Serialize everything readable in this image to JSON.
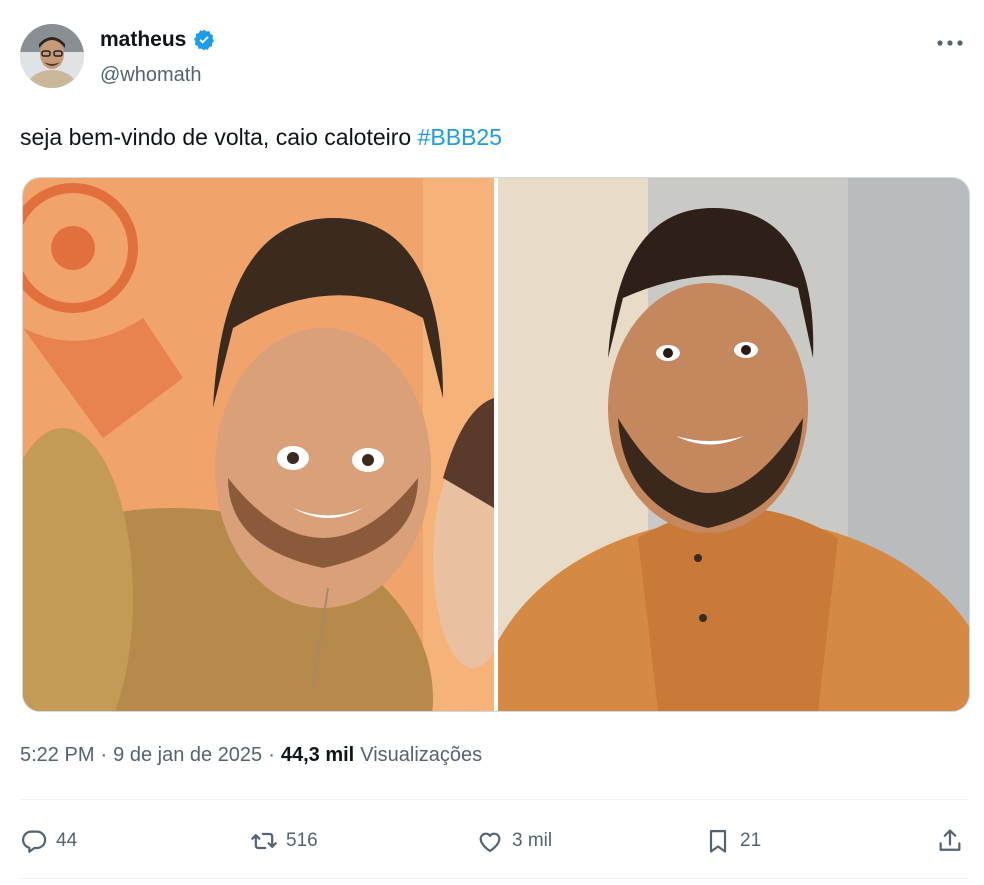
{
  "tweet": {
    "author": {
      "name": "matheus",
      "handle": "@whomath",
      "verified": true
    },
    "text": "seja bem-vindo de volta, caio caloteiro",
    "hashtag": "#BBB25",
    "time": "5:22 PM",
    "separator": "·",
    "date": "9 de jan de 2025",
    "views_count": "44,3 mil",
    "views_label": "Visualizações",
    "stats": {
      "replies": "44",
      "retweets": "516",
      "likes": "3 mil",
      "bookmarks": "21"
    },
    "media": [
      {
        "icon": "selfie-photo",
        "description": "man selfie orange background"
      },
      {
        "icon": "portrait-photo",
        "description": "smiling man orange shirt"
      }
    ]
  },
  "colors": {
    "accent": "#1d9bf0",
    "secondary_text": "#536471",
    "primary_text": "#0f1419",
    "border": "#cfd9de"
  }
}
